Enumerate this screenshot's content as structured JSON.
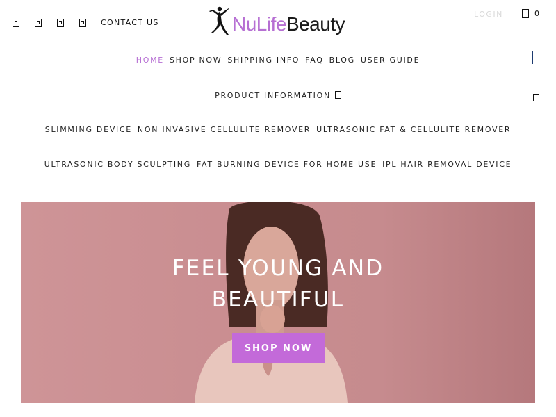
{
  "header": {
    "social_icons": [
      "facebook-icon",
      "twitter-icon",
      "instagram-icon",
      "pinterest-icon"
    ],
    "contact_label": "CONTACT US",
    "logo": {
      "part1": "NuLife",
      "part2": "Beauty",
      "accent_color": "#b66fd3"
    },
    "login_label": "LOGIN",
    "cart_count": "0"
  },
  "nav": {
    "row1": [
      "HOME",
      "SHOP NOW",
      "SHIPPING INFO",
      "FAQ",
      "BLOG",
      "USER GUIDE"
    ],
    "row2": [
      "PRODUCT INFORMATION"
    ],
    "row3": [
      "SLIMMING DEVICE",
      "NON INVASIVE CELLULITE REMOVER",
      "ULTRASONIC FAT & CELLULITE REMOVER"
    ],
    "row4": [
      "ULTRASONIC BODY SCULPTING",
      "FAT BURNING DEVICE FOR HOME USE",
      "IPL HAIR REMOVAL DEVICE"
    ],
    "active": "HOME"
  },
  "hero": {
    "title_line1": "FEEL YOUNG AND",
    "title_line2": "BEAUTIFUL",
    "button_label": "SHOP NOW",
    "button_color": "#c36ad9",
    "background_color": "#c98d90"
  }
}
